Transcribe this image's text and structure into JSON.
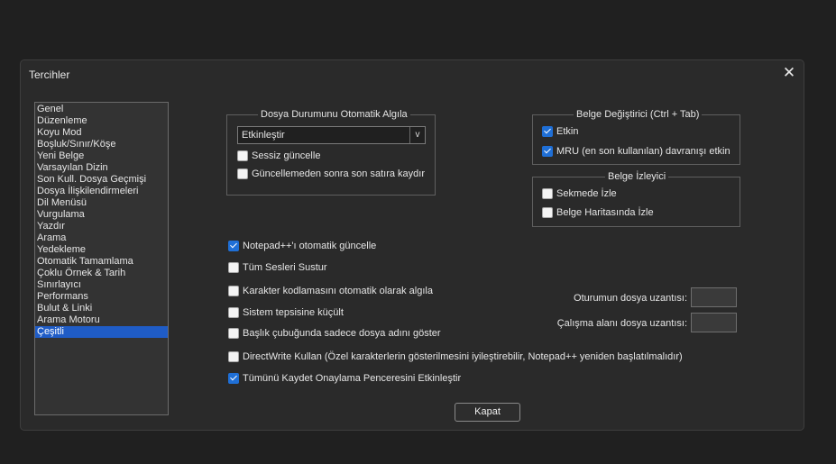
{
  "dialog": {
    "title": "Tercihler"
  },
  "categories": [
    {
      "label": "Genel"
    },
    {
      "label": "Düzenleme"
    },
    {
      "label": "Koyu Mod"
    },
    {
      "label": "Boşluk/Sınır/Köşe"
    },
    {
      "label": "Yeni Belge"
    },
    {
      "label": "Varsayılan Dizin"
    },
    {
      "label": "Son Kull. Dosya Geçmişi"
    },
    {
      "label": "Dosya İlişkilendirmeleri"
    },
    {
      "label": "Dil Menüsü"
    },
    {
      "label": "Vurgulama"
    },
    {
      "label": "Yazdır"
    },
    {
      "label": "Arama"
    },
    {
      "label": "Yedekleme"
    },
    {
      "label": "Otomatik Tamamlama"
    },
    {
      "label": "Çoklu Örnek & Tarih"
    },
    {
      "label": "Sınırlayıcı"
    },
    {
      "label": "Performans"
    },
    {
      "label": "Bulut & Linki"
    },
    {
      "label": "Arama Motoru"
    },
    {
      "label": "Çeşitli",
      "selected": true
    }
  ],
  "file_status": {
    "legend": "Dosya Durumunu Otomatik Algıla",
    "select_value": "Etkinleştir",
    "silent_update": {
      "label": "Sessiz güncelle",
      "checked": false
    },
    "scroll_last_line": {
      "label": "Güncellemeden sonra son satıra kaydır",
      "checked": false
    }
  },
  "doc_switcher": {
    "legend": "Belge Değiştirici (Ctrl + Tab)",
    "enabled": {
      "label": "Etkin",
      "checked": true
    },
    "mru": {
      "label": "MRU (en son kullanılan) davranışı etkin",
      "checked": true
    }
  },
  "doc_monitor": {
    "legend": "Belge İzleyici",
    "follow_tab": {
      "label": "Sekmede İzle",
      "checked": false
    },
    "follow_map": {
      "label": "Belge Haritasında İzle",
      "checked": false
    }
  },
  "options": {
    "auto_update": {
      "label": "Notepad++'ı otomatik güncelle",
      "checked": true
    },
    "mute_sounds": {
      "label": "Tüm Sesleri Sustur",
      "checked": false
    },
    "detect_encoding": {
      "label": "Karakter kodlamasını otomatik olarak algıla",
      "checked": false
    },
    "minimize_tray": {
      "label": "Sistem tepsisine küçült",
      "checked": false
    },
    "title_filename": {
      "label": "Başlık çubuğunda sadece dosya adını göster",
      "checked": false
    },
    "directwrite": {
      "label": "DirectWrite Kullan (Özel karakterlerin gösterilmesini iyileştirebilir, Notepad++ yeniden başlatılmalıdır)",
      "checked": false
    },
    "save_all_confirm": {
      "label": "Tümünü Kaydet Onaylama Penceresini Etkinleştir",
      "checked": true
    }
  },
  "extensions": {
    "session_label": "Oturumun dosya uzantısı:",
    "session_value": "",
    "workspace_label": "Çalışma alanı dosya uzantısı:",
    "workspace_value": ""
  },
  "buttons": {
    "close": "Kapat"
  },
  "colors": {
    "accent": "#1f6fd6",
    "selection": "#1f5cc6"
  }
}
